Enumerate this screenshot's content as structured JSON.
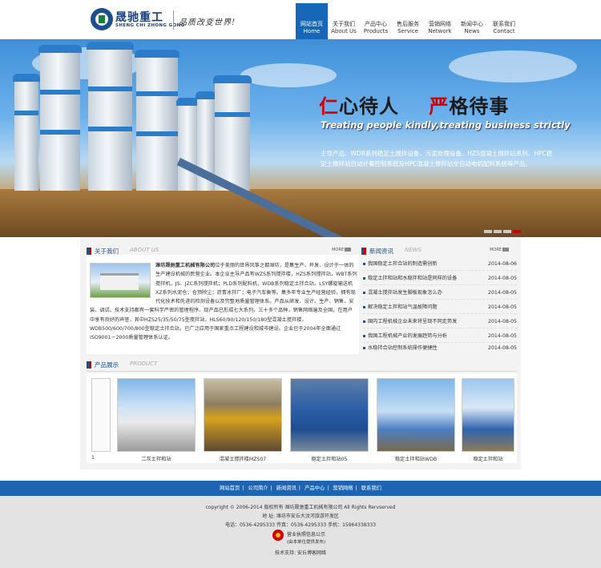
{
  "logo": {
    "cn": "晟驰重工",
    "en": "SHENG CHI ZHONG GONG",
    "slogan": "品质改变世界!"
  },
  "nav": [
    {
      "cn": "网站首页",
      "en": "Home",
      "active": true
    },
    {
      "cn": "关于我们",
      "en": "About Us"
    },
    {
      "cn": "产品中心",
      "en": "Products"
    },
    {
      "cn": "售后服务",
      "en": "Service"
    },
    {
      "cn": "营销网络",
      "en": "Network"
    },
    {
      "cn": "新闻中心",
      "en": "News"
    },
    {
      "cn": "联系我们",
      "en": "Contact"
    }
  ],
  "banner": {
    "headline_a_first": "仁",
    "headline_a_rest": "心待人",
    "headline_b_first": "严",
    "headline_b_rest": "格待事",
    "headline_en": "Treating people kindly,treating business strictly",
    "text": "主导产品：WDB系列稳定土搅拌设备、污泥处理设备、HZS混凝土搅拌站系列、HPC稳定土搅拌站自动计量控制系统及HPC混凝土搅拌站全自动电机配料系统等产品。"
  },
  "about": {
    "title_cn": "关于我们",
    "title_en": "ABOUT US",
    "more": "MORE",
    "company": "潍坊晟驰重工机械有限公司",
    "text": "位于美丽的世界风筝之都潍坊，是集生产、开发、设计于一体的生产建设机械的民营企业。本企业主导产品有WZS系列搅拌楼，HZS系列搅拌站，WBT系列搅拌机，JS、JZC系列搅拌机；PLD系列配料机，WDB系列稳定土拌合站，LSY螺旋输送机XZ系列水泥仓；仓顶除尘；沥青冰拌厂；电子汽车衡等。集多年专业生产经营经验，拥有现代化技术和先进的检测设备以及完整地质量管理体系。产品从研发、设计、生产、销售、安装、调试、技术支持都有一套科学严密的管理程序。现产品已形成七大系列，三十多个品种，销售网络遍及全国，在用户中享有良好的声誉，其中HZS25/35/50/75型搅拌站，HLS60/90/120/150/180型混凝土搅拌楼，WDB500/600/700/800型稳定土拌合站，已广泛应用于国家重点工程建设和城市建设。企业已于2004年全面通过ISO9001－2000质量管理体系认证。"
  },
  "news": {
    "title_cn": "新闻资讯",
    "title_en": "NEWS",
    "more": "MORE",
    "items": [
      {
        "title": "我国稳定土拌合站的制造需创新",
        "date": "2014-08-06"
      },
      {
        "title": "稳定土拌和站和水稳拌和站是同样的设备",
        "date": "2014-08-05"
      },
      {
        "title": "混凝土搅拌站发生脚板现象怎么办",
        "date": "2014-08-05"
      },
      {
        "title": "解决稳定土拌和站气温故障问题",
        "date": "2014-08-05"
      },
      {
        "title": "国内工程机械企业未来将呈现不同走势发",
        "date": "2014-08-05"
      },
      {
        "title": "我国工程机械产业的发展趋势与分析",
        "date": "2014-08-05"
      },
      {
        "title": "水稳拌合站控制系统操作便捷性",
        "date": "2014-08-05"
      }
    ]
  },
  "products": {
    "title_cn": "产品展示",
    "title_en": "PRODUCT",
    "items": [
      {
        "caption": "1"
      },
      {
        "caption": "二灰土拌和站"
      },
      {
        "caption": "混凝土搅拌楼MZS07"
      },
      {
        "caption": "稳定土拌和站05"
      },
      {
        "caption": "稳定土拌和站WDB"
      },
      {
        "caption": "稳定土拌和站"
      }
    ]
  },
  "footer_nav": [
    "网站首页",
    "公司简介",
    "新闻资讯",
    "产品中心",
    "营销网络",
    "联系我们"
  ],
  "footer": {
    "copyright": "copyright © 2006-2014 版权所有 潍坊晟驰重工机械有限公司 All Rights Rervserved",
    "address": "地 址: 潍坊市安丘大汶河旅游开发区",
    "phone": "电话：0536-4295333  传真：0536-4295333  手机：15964338333",
    "license": "营业执照信息公示",
    "license_sub": "(由本单位提供发布)",
    "support": "技术支持: 安丘博客网络"
  },
  "colors": {
    "brand_blue": "#1d64b3",
    "accent_red": "#d40000"
  }
}
